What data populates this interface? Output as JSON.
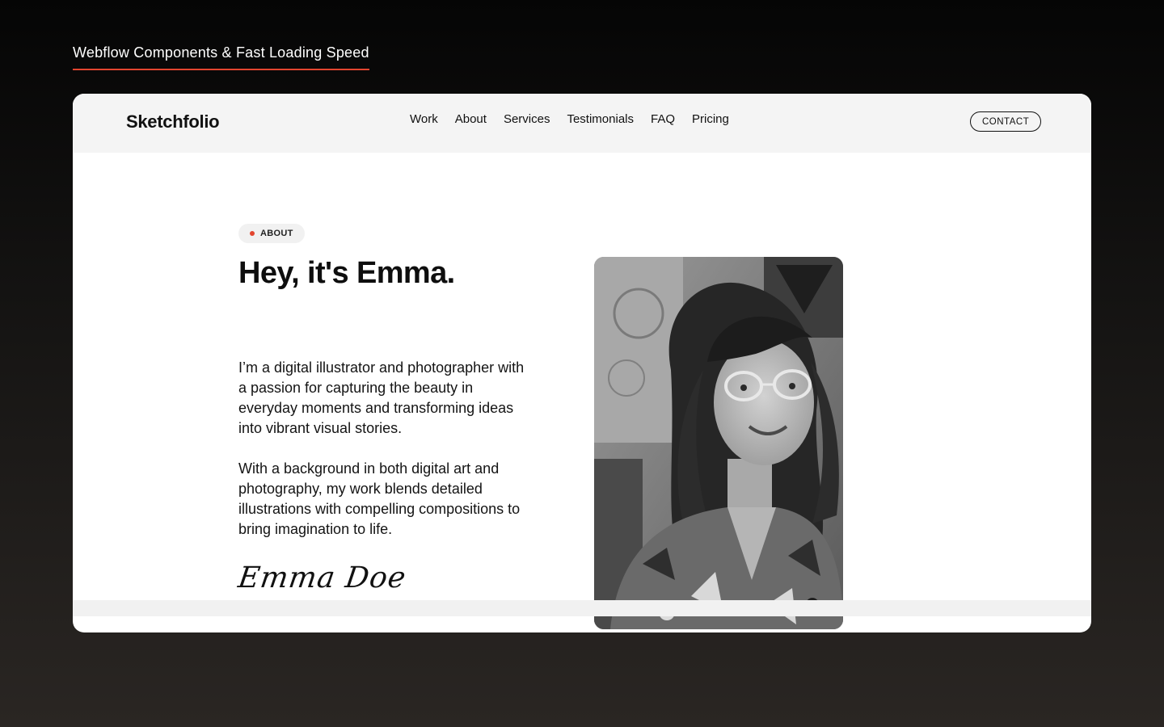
{
  "promo": {
    "caption": "Webflow Components & Fast Loading Speed",
    "accent_color": "#e2452f"
  },
  "navbar": {
    "brand": "Sketchfolio",
    "links": [
      "Work",
      "About",
      "Services",
      "Testimonials",
      "FAQ",
      "Pricing"
    ],
    "contact_label": "CONTACT"
  },
  "about": {
    "badge_label": "ABOUT",
    "badge_dot_color": "#e2452f",
    "headline": "Hey, it's Emma.",
    "paragraph_1": "I’m a digital illustrator and photographer with a passion for capturing the beauty in everyday moments and transforming ideas into vibrant visual stories.",
    "paragraph_2": "With a background in both digital art and photography, my work blends detailed illustrations with compelling compositions to bring imagination to life.",
    "signature": "Emma Doe",
    "portrait_icon": "portrait-photo"
  }
}
